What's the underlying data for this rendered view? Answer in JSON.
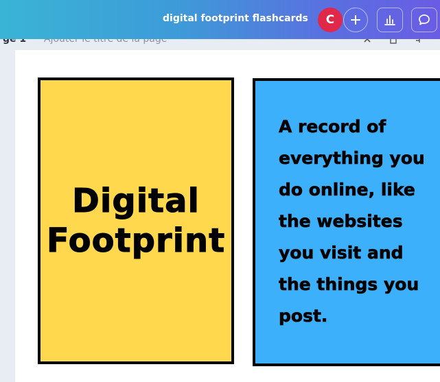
{
  "toolbar": {
    "document_title": "digital footprint flashcards",
    "avatar_initial": "C",
    "add_collaborator_icon": "plus-icon",
    "insights_icon": "bar-chart-icon",
    "comments_icon": "comment-icon",
    "colors": {
      "avatar": "#e0284a"
    }
  },
  "page_header": {
    "page_label": "ge 1",
    "page_title_placeholder": "Ajouter le titre de la page"
  },
  "cards": {
    "front": {
      "lines": [
        "Digital",
        "Footprint"
      ],
      "background": "#ffd84e"
    },
    "back": {
      "lines": [
        "A record of",
        "everything you",
        "do online, like",
        "the websites",
        "you visit and",
        "the things you",
        "post."
      ],
      "background": "#3cb0fa"
    }
  }
}
